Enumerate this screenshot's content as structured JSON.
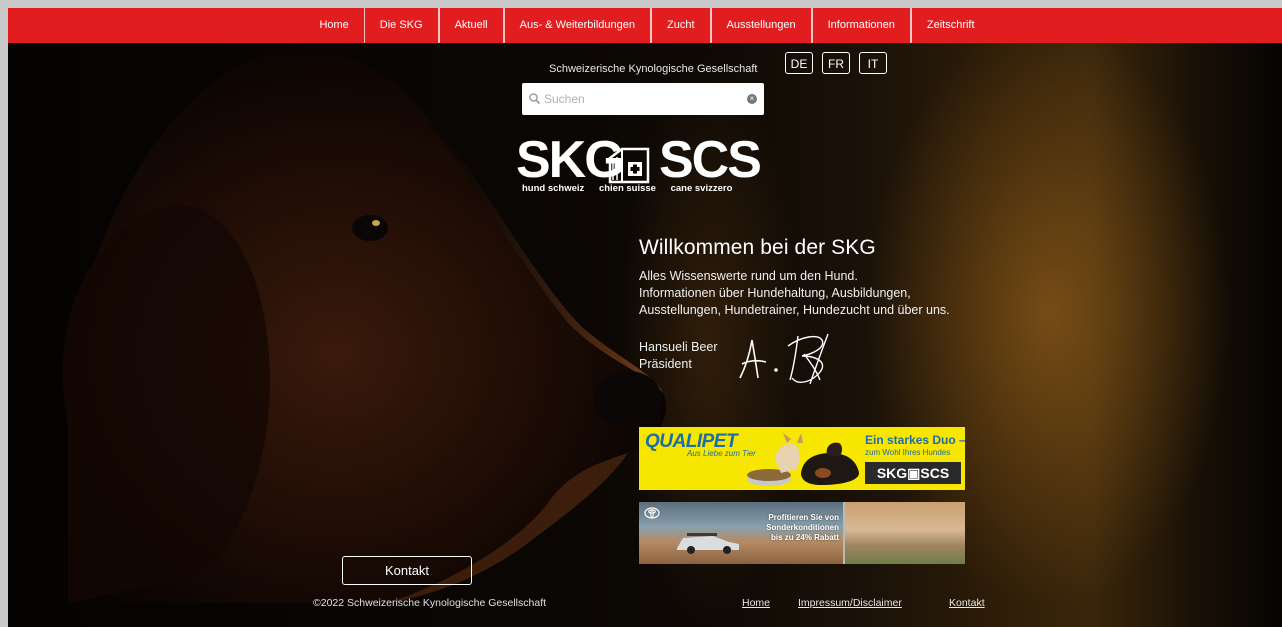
{
  "nav": {
    "items": [
      {
        "label": "Home"
      },
      {
        "label": "Die SKG"
      },
      {
        "label": "Aktuell"
      },
      {
        "label": "Aus- & Weiterbildungen"
      },
      {
        "label": "Zucht"
      },
      {
        "label": "Ausstellungen"
      },
      {
        "label": "Informationen"
      },
      {
        "label": "Zeitschrift"
      }
    ]
  },
  "header": {
    "org_name": "Schweizerische Kynologische Gesellschaft",
    "languages": [
      "DE",
      "FR",
      "IT"
    ],
    "search_placeholder": "Suchen"
  },
  "logo": {
    "left": "SKG",
    "right": "SCS",
    "sub": [
      "hund schweiz",
      "chien suisse",
      "cane svizzero"
    ]
  },
  "welcome": {
    "title": "Willkommen bei der SKG",
    "lines": [
      "Alles Wissenswerte rund um den Hund.",
      "Informationen über Hundehaltung, Ausbildungen,",
      "Ausstellungen, Hundetrainer, Hundezucht und über uns."
    ],
    "signer_name": "Hansueli Beer",
    "signer_role": "Präsident"
  },
  "ads": {
    "qualipet": {
      "brand": "QUALIPET",
      "tagline": "Aus Liebe zum Tier",
      "headline": "Ein starkes Duo –",
      "subline": "zum Wohl Ihres Hundes",
      "badge": "SKG▣SCS"
    },
    "toyota": {
      "line1": "Profitieren Sie von",
      "line2": "Sonderkonditionen",
      "line3": "bis zu 24% Rabatt"
    }
  },
  "footer": {
    "contact_button": "Kontakt",
    "copyright": "©2022 Schweizerische Kynologische Gesellschaft",
    "links": [
      "Home",
      "Impressum/Disclaimer",
      "Kontakt"
    ]
  },
  "colors": {
    "nav_bg": "#e11d1f",
    "qualipet_yellow": "#f6e600",
    "qualipet_blue": "#1d6ea7"
  }
}
